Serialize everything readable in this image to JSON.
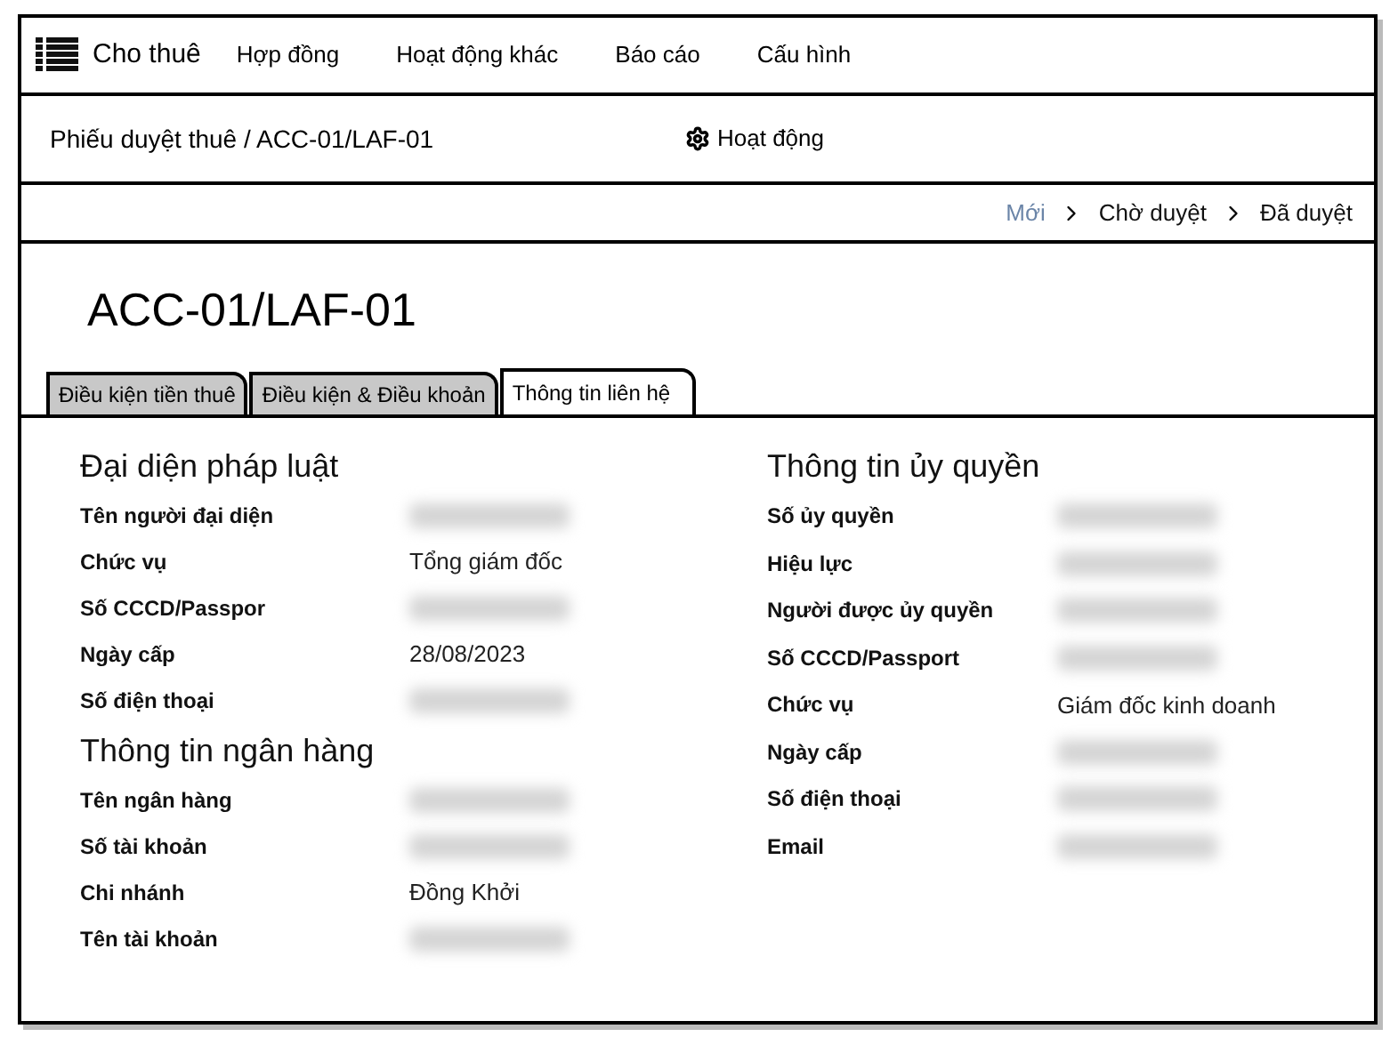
{
  "nav": {
    "app_title": "Cho thuê",
    "items": [
      "Hợp đồng",
      "Hoạt động khác",
      "Báo cáo",
      "Cấu hình"
    ]
  },
  "breadcrumb": {
    "path": "Phiếu duyệt thuê / ACC-01/LAF-01",
    "action": "Hoạt động"
  },
  "status_steps": [
    {
      "label": "Mới",
      "selected": true
    },
    {
      "label": "Chờ duyệt",
      "selected": false
    },
    {
      "label": "Đã duyệt",
      "selected": false
    }
  ],
  "record_title": "ACC-01/LAF-01",
  "tabs": [
    {
      "label": "Điều kiện tiền thuê",
      "selected": false
    },
    {
      "label": "Điều kiện & Điều khoản",
      "selected": false
    },
    {
      "label": "Thông tin liên hệ",
      "selected": true
    }
  ],
  "left_sections": [
    {
      "title": "Đại diện pháp luật",
      "fields": [
        {
          "label": "Tên người đại diện",
          "kind": "blurred"
        },
        {
          "label": "Chức vụ",
          "kind": "text",
          "value": "Tổng giám đốc"
        },
        {
          "label": "Số CCCD/Passpor",
          "kind": "blurred"
        },
        {
          "label": "Ngày cấp",
          "kind": "text",
          "value": "28/08/2023"
        },
        {
          "label": "Số điện thoại",
          "kind": "blurred"
        }
      ]
    },
    {
      "title": "Thông tin ngân hàng",
      "fields": [
        {
          "label": "Tên ngân hàng",
          "kind": "blurred"
        },
        {
          "label": "Số tài khoản",
          "kind": "blurred"
        },
        {
          "label": "Chi nhánh",
          "kind": "text",
          "value": "Đồng Khởi"
        },
        {
          "label": "Tên tài khoản",
          "kind": "blurred"
        }
      ]
    }
  ],
  "right_sections": [
    {
      "title": "Thông tin ủy quyền",
      "fields": [
        {
          "label": "Số ủy quyền",
          "kind": "blurred"
        },
        {
          "label": "Hiệu lực",
          "kind": "blurred"
        },
        {
          "label": "Người được ủy quyền",
          "kind": "blurred"
        },
        {
          "label": "Số CCCD/Passport",
          "kind": "blurred"
        },
        {
          "label": "Chức vụ",
          "kind": "text",
          "value": "Giám đốc kinh doanh"
        },
        {
          "label": "Ngày cấp",
          "kind": "blurred"
        },
        {
          "label": "Số điện thoại",
          "kind": "blurred"
        },
        {
          "label": "Email",
          "kind": "blurred"
        }
      ]
    }
  ]
}
